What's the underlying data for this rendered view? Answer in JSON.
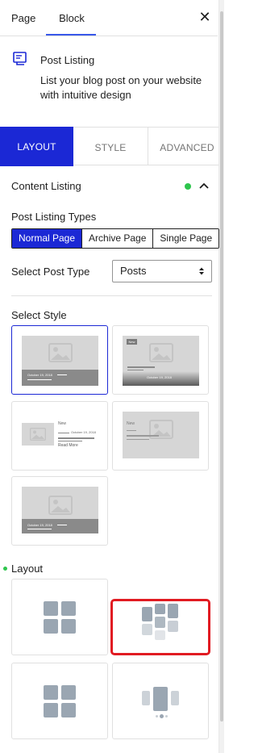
{
  "top_tabs": {
    "page": "Page",
    "block": "Block",
    "close": "✕"
  },
  "block_card": {
    "title": "Post Listing",
    "description": "List your blog post on your website with intuitive design"
  },
  "style_tabs": {
    "layout": "LAYOUT",
    "style": "STYLE",
    "advanced": "ADVANCED"
  },
  "content_listing": {
    "title": "Content Listing",
    "post_listing_types_label": "Post Listing Types",
    "types": [
      "Normal Page",
      "Archive Page",
      "Single Page"
    ],
    "active_type": "Normal Page",
    "select_post_type_label": "Select Post Type",
    "post_type_value": "Posts",
    "select_style_label": "Select Style",
    "thumb_date": "October 19, 2018",
    "thumb_new": "New",
    "thumb_read_more": "Read More"
  },
  "layout": {
    "label": "Layout"
  },
  "colors": {
    "accent": "#1b28d5",
    "highlight": "#e11b22",
    "status": "#2ec54d"
  }
}
